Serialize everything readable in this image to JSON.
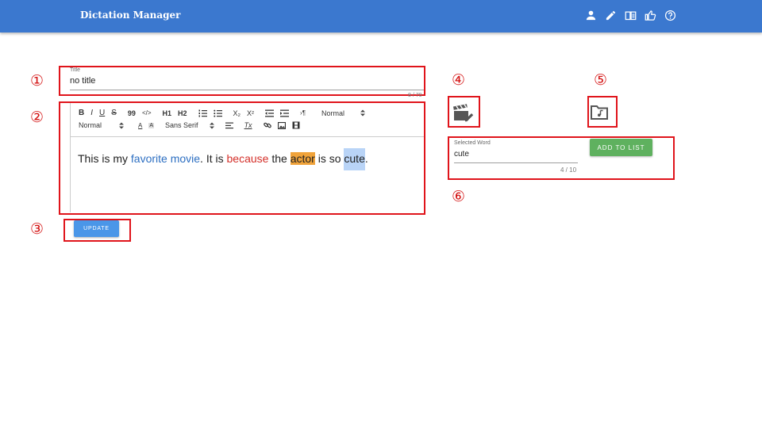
{
  "appbar": {
    "title": "Dictation Manager",
    "icons": [
      "account-icon",
      "pencil-icon",
      "book-icon",
      "thumb-up-icon",
      "help-icon"
    ],
    "color": "#3b78cf"
  },
  "markers": [
    "①",
    "②",
    "③",
    "④",
    "⑤",
    "⑥"
  ],
  "title_field": {
    "label": "Title",
    "value": "no title",
    "counter": "8 / 70"
  },
  "toolbar": {
    "row1": [
      "B",
      "I",
      "U",
      "S",
      "99",
      "</>",
      "H1",
      "H2",
      "ordered-list",
      "bullet-list",
      "X₂",
      "X²",
      "outdent",
      "indent",
      "›¶",
      "Normal"
    ],
    "row2": [
      "Normal",
      "A",
      "A",
      "Sans Serif",
      "align",
      "Tx",
      "link",
      "image",
      "video"
    ],
    "header_select": "Normal",
    "size_select": "Normal",
    "font_select": "Sans Serif"
  },
  "editor": {
    "segments": [
      {
        "text": "This is my ",
        "style": "plain"
      },
      {
        "text": "favorite movie",
        "style": "blue"
      },
      {
        "text": ". It is ",
        "style": "plain"
      },
      {
        "text": "because",
        "style": "red"
      },
      {
        "text": " the ",
        "style": "plain"
      },
      {
        "text": "actor",
        "style": "highlight"
      },
      {
        "text": " is so ",
        "style": "plain"
      },
      {
        "text": "cute",
        "style": "selected"
      },
      {
        "text": ".",
        "style": "plain"
      }
    ]
  },
  "buttons": {
    "update": "UPDATE",
    "add_to_list": "ADD TO LIST"
  },
  "selected_word": {
    "label": "Selected Word",
    "value": "cute",
    "counter": "4 / 10"
  },
  "colors": {
    "annotation_red": "#e0141b",
    "update_blue": "#4a96e8",
    "add_green": "#5fb15f",
    "icon_gray": "#555555"
  }
}
